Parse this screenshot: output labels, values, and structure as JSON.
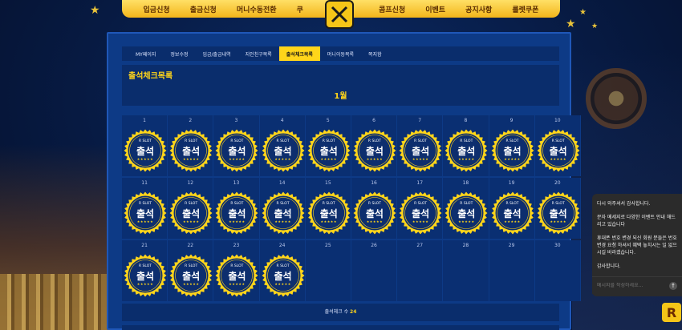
{
  "top_nav": {
    "items": [
      "입금신청",
      "출금신청",
      "머니수동전환",
      "쿠",
      "콤프신청",
      "이벤트",
      "공지사항",
      "룰렛쿠폰"
    ]
  },
  "tabs": [
    {
      "label": "MY페이지",
      "active": false
    },
    {
      "label": "정보수정",
      "active": false
    },
    {
      "label": "입금/출금내역",
      "active": false
    },
    {
      "label": "지인친구목록",
      "active": false
    },
    {
      "label": "출석체크목록",
      "active": true
    },
    {
      "label": "머니이동목록",
      "active": false
    },
    {
      "label": "쪽지함",
      "active": false
    }
  ],
  "section": {
    "title": "출석체크목록",
    "month": "1월"
  },
  "calendar": {
    "badge_brand": "R SLOT",
    "badge_text": "출석",
    "badge_stars": "★★★★★",
    "days": [
      {
        "num": "1",
        "checked": true
      },
      {
        "num": "2",
        "checked": true
      },
      {
        "num": "3",
        "checked": true
      },
      {
        "num": "4",
        "checked": true
      },
      {
        "num": "5",
        "checked": true
      },
      {
        "num": "6",
        "checked": true
      },
      {
        "num": "7",
        "checked": true
      },
      {
        "num": "8",
        "checked": true
      },
      {
        "num": "9",
        "checked": true
      },
      {
        "num": "10",
        "checked": true
      },
      {
        "num": "11",
        "checked": true
      },
      {
        "num": "12",
        "checked": true
      },
      {
        "num": "13",
        "checked": true
      },
      {
        "num": "14",
        "checked": true
      },
      {
        "num": "15",
        "checked": true
      },
      {
        "num": "16",
        "checked": true
      },
      {
        "num": "17",
        "checked": true
      },
      {
        "num": "18",
        "checked": true
      },
      {
        "num": "19",
        "checked": true
      },
      {
        "num": "20",
        "checked": true
      },
      {
        "num": "21",
        "checked": true
      },
      {
        "num": "22",
        "checked": true
      },
      {
        "num": "23",
        "checked": true
      },
      {
        "num": "24",
        "checked": true
      },
      {
        "num": "25",
        "checked": false
      },
      {
        "num": "26",
        "checked": false
      },
      {
        "num": "27",
        "checked": false
      },
      {
        "num": "28",
        "checked": false
      },
      {
        "num": "29",
        "checked": false
      },
      {
        "num": "30",
        "checked": false
      }
    ]
  },
  "footer": {
    "label": "출석체크 수",
    "count": "24"
  },
  "chat": {
    "messages": [
      "다시 와주셔서 감사합니다.",
      "문자 메세지로 다양한 이벤트 안내 해드리고 있습니다",
      "휴대폰 번호 변경 되신 회원 분들은 번호 변경 요청 하셔서 혜택 놓치시는 일 없으시길 바라겠습니다.",
      "감사합니다."
    ],
    "placeholder": "메시지를 작성하세요..."
  },
  "logo_letter": "R",
  "colors": {
    "accent": "#ffd51a",
    "panel": "#0d3a86",
    "nav": "#f3b51a"
  }
}
